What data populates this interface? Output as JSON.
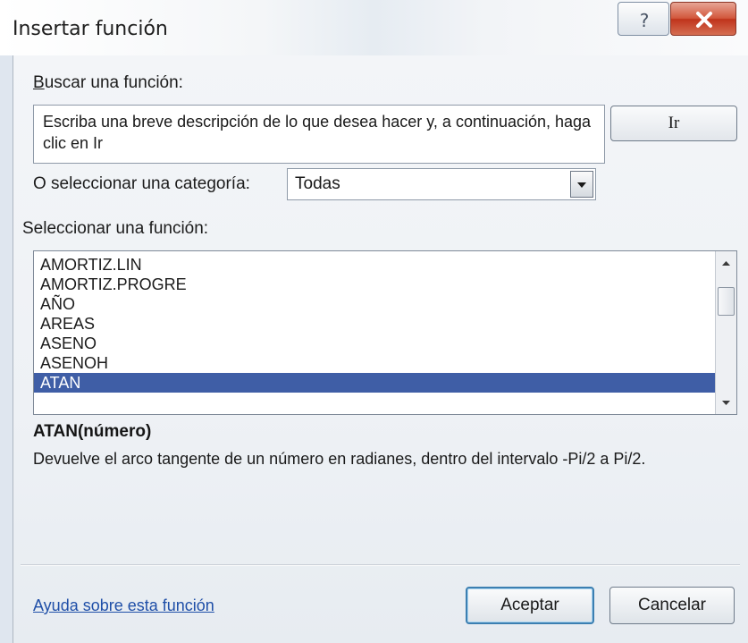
{
  "window": {
    "title": "Insertar función",
    "help_button_icon": "question-icon",
    "close_button_icon": "close-icon"
  },
  "search": {
    "label": "Buscar una función:",
    "box_text": "Escriba una breve descripción de lo que desea hacer y, a continuación, haga clic en Ir",
    "go_button_label": "Ir"
  },
  "category": {
    "label": "O seleccionar una categoría:",
    "selected_value": "Todas"
  },
  "function_list": {
    "label": "Seleccionar una función:",
    "items": [
      "AMORTIZ.LIN",
      "AMORTIZ.PROGRE",
      "AÑO",
      "AREAS",
      "ASENO",
      "ASENOH",
      "ATAN"
    ],
    "selected_index": 6,
    "selection_color": "#3f5ea6"
  },
  "details": {
    "syntax": "ATAN(número)",
    "description": "Devuelve el arco tangente de un número en radianes, dentro del intervalo -Pi/2 a Pi/2."
  },
  "footer": {
    "help_link": "Ayuda sobre esta función",
    "ok_button_label": "Aceptar",
    "cancel_button_label": "Cancelar"
  }
}
